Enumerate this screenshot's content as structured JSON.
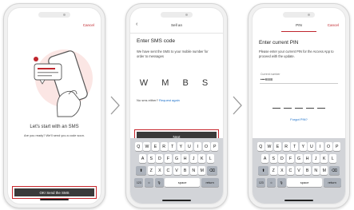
{
  "screen1": {
    "cancel": "Cancel",
    "title": "Let's start with an SMS",
    "subtitle": "Are you ready? We'll send you a code soon.",
    "button": "OK! Send the SMS"
  },
  "screen2": {
    "top_title": "Sell an",
    "heading": "Enter SMS code",
    "instructions": "We have sent the SMS to your mobile number for order to messages",
    "code": "W M B S",
    "no_sms": "No sms either?",
    "request_link": "Request again",
    "button": "Next"
  },
  "screen3": {
    "top_title": "PIN",
    "cancel": "Cancel",
    "heading": "Enter current PIN",
    "instructions": "Please enter your current PIN for the Access App to proceed with the update.",
    "field_label": "Current number",
    "field_value": "••••9888",
    "forgot": "Forgot PIN?"
  },
  "keyboard": {
    "row1": [
      "Q",
      "W",
      "E",
      "R",
      "T",
      "Y",
      "U",
      "I",
      "O",
      "P"
    ],
    "row2": [
      "A",
      "S",
      "D",
      "F",
      "G",
      "H",
      "J",
      "K",
      "L"
    ],
    "row3": [
      "Z",
      "X",
      "C",
      "V",
      "B",
      "N",
      "M"
    ],
    "numbers_key": "123",
    "space_key": "space",
    "return_key": "return"
  },
  "colors": {
    "accent": "#c0262d",
    "button": "#3a3a3a",
    "link": "#1a6fc9"
  }
}
